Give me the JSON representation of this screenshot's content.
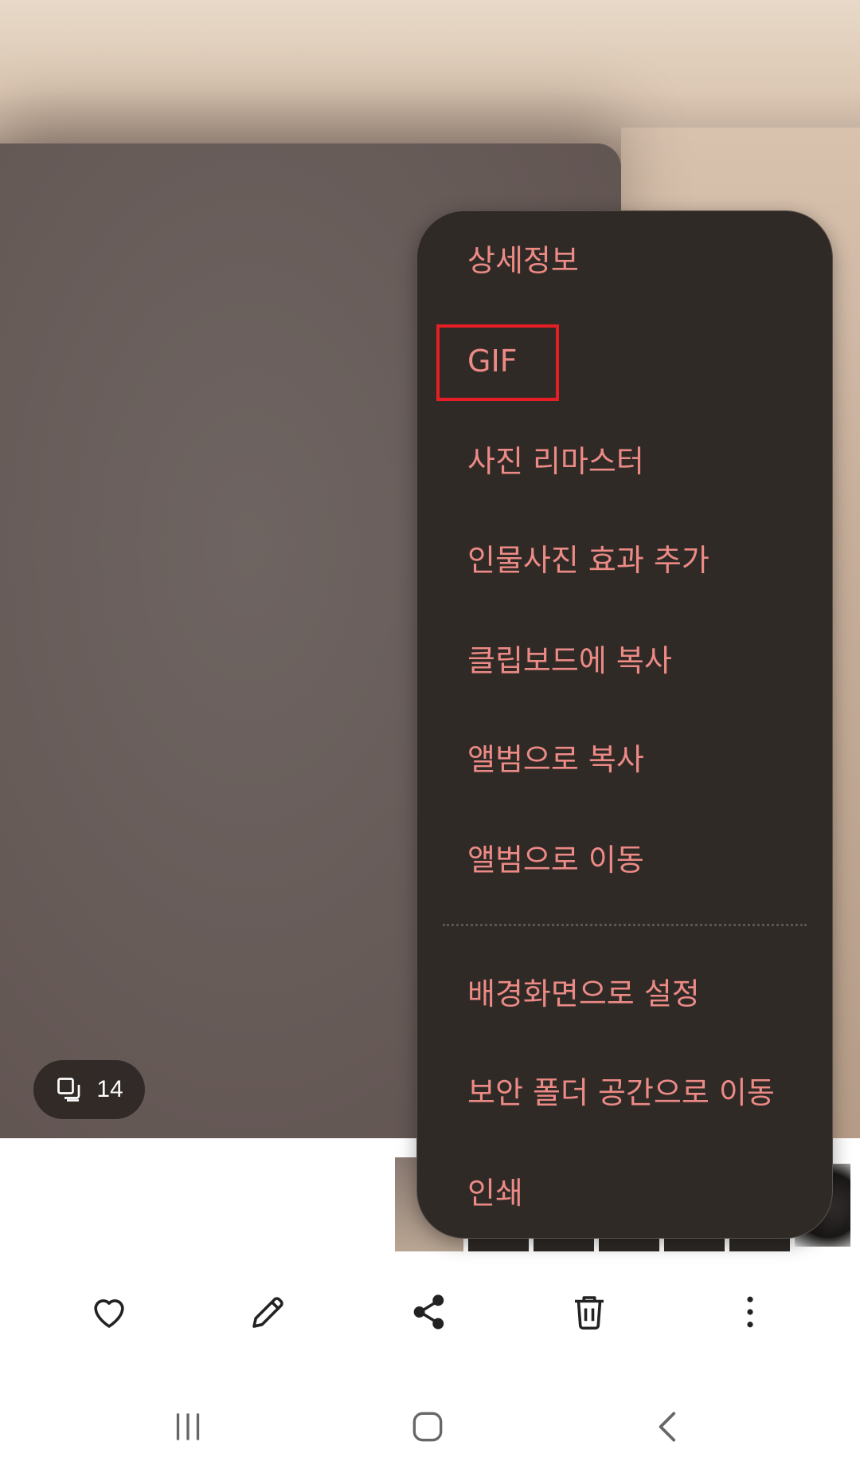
{
  "photo": {
    "count_badge": "14",
    "count_icon": "multi-image-icon"
  },
  "menu": {
    "items": [
      {
        "label": "상세정보"
      },
      {
        "label": "GIF",
        "highlighted": true
      },
      {
        "label": "사진 리마스터"
      },
      {
        "label": "인물사진 효과 추가"
      },
      {
        "label": "클립보드에 복사"
      },
      {
        "label": "앨범으로 복사"
      },
      {
        "label": "앨범으로 이동"
      },
      {
        "label": "배경화면으로 설정"
      },
      {
        "label": "보안 폴더 공간으로 이동"
      },
      {
        "label": "인쇄"
      }
    ],
    "text_color": "#ec8a86",
    "background": "#302a26",
    "highlight_color": "#e41e24"
  },
  "action_bar": {
    "icons": [
      "heart-icon",
      "edit-pencil-icon",
      "share-icon",
      "delete-trash-icon",
      "more-vertical-icon"
    ]
  },
  "nav_bar": {
    "icons": [
      "recent-apps-icon",
      "home-icon",
      "back-icon"
    ]
  }
}
